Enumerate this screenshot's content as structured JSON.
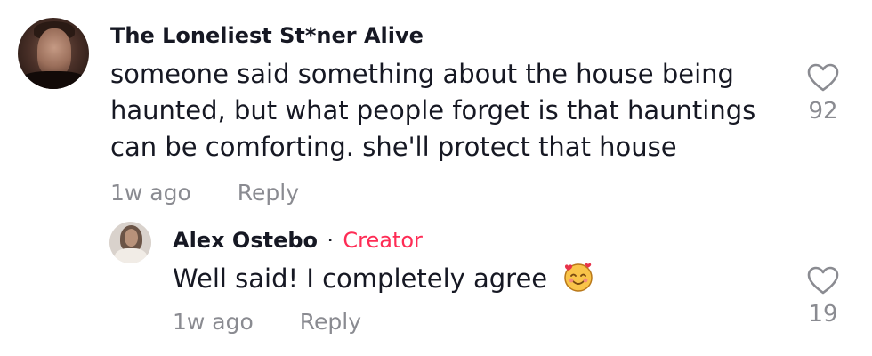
{
  "comment": {
    "username": "The Loneliest St*ner Alive",
    "text": "someone said something about the house being haunted, but what people forget is that hauntings can be comforting. she'll protect that house",
    "time": "1w ago",
    "reply_label": "Reply",
    "like_count": "92"
  },
  "reply": {
    "username": "Alex Ostebo",
    "separator": "·",
    "badge": "Creator",
    "text": "Well said! I completely agree",
    "emoji_icon": "smiling-face-with-hearts-icon",
    "time": "1w ago",
    "reply_label": "Reply",
    "like_count": "19"
  },
  "colors": {
    "creator_badge": "#fe2c55",
    "meta_text": "#8a8b91",
    "primary_text": "#161823"
  }
}
